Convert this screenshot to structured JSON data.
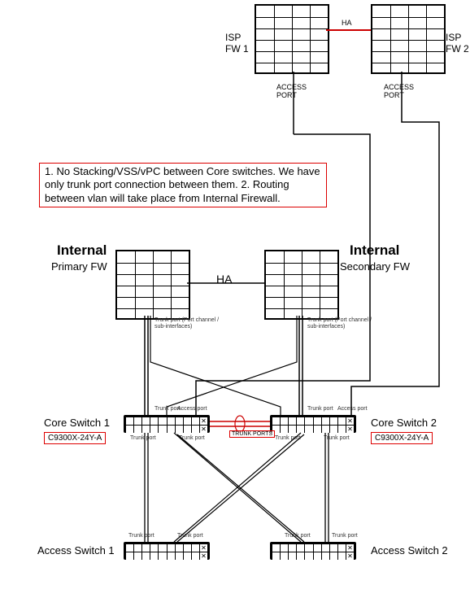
{
  "top": {
    "isp_fw1": "ISP\nFW 1",
    "isp_fw2": "ISP\nFW 2",
    "ha": "HA",
    "access_port_1": "ACCESS\nPORT",
    "access_port_2": "ACCESS\nPORT"
  },
  "note": "1. No Stacking/VSS/vPC between Core switches. We have only trunk port connection between them.\n2. Routing between vlan will take place from Internal Firewall.",
  "internal": {
    "title_left": "Internal",
    "sub_left": "Primary FW",
    "title_right": "Internal",
    "sub_right": "Secondary FW",
    "ha": "HA",
    "trunk_caption_left": "Trunk port (Port channel /\nsub-interfaces)",
    "trunk_caption_right": "Trunk port (Port channel /\nsub-interfaces)"
  },
  "core": {
    "left_label": "Core Switch 1",
    "left_model": "C9300X-24Y-A",
    "right_label": "Core Switch 2",
    "right_model": "C9300X-24Y-A",
    "trunk_ports": "TRUNK\nPORTS",
    "port_trunk": "Trunk port",
    "port_access": "Access port"
  },
  "access": {
    "left_label": "Access Switch 1",
    "right_label": "Access Switch 2"
  },
  "colors": {
    "ha_line": "#cc0000",
    "trunk_line": "#cc0000",
    "wire": "#000000"
  }
}
